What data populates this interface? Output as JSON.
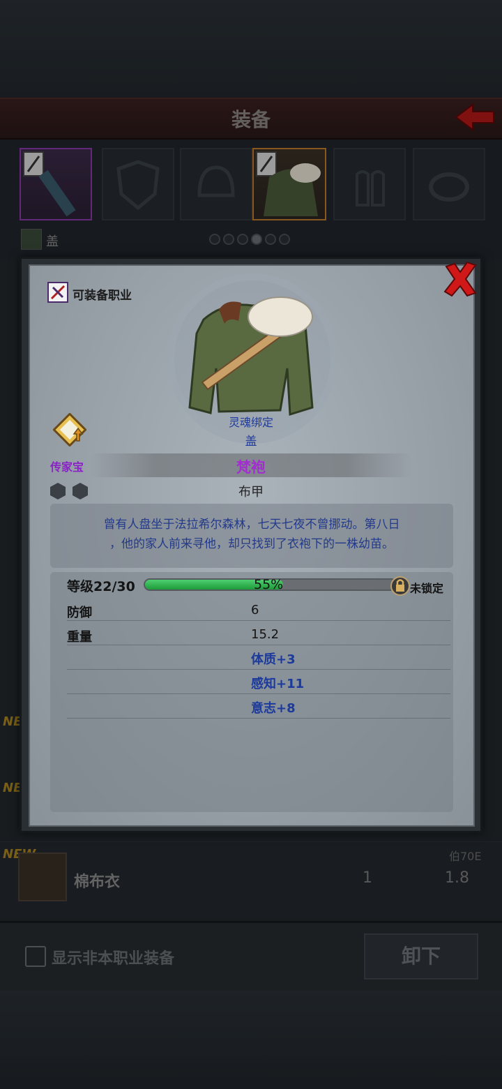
{
  "header": {
    "title": "装备"
  },
  "slots": {
    "character_name": "盖",
    "page_count": 6,
    "active_page": 4
  },
  "list": {
    "new_tags": [
      "NEW",
      "NEW",
      "NEW"
    ],
    "visible_item": {
      "name": "棉布衣",
      "requirement": "伯70E",
      "value1": "1",
      "value2": "1.8"
    }
  },
  "bottom_bar": {
    "show_other_class_label": "显示非本职业装备",
    "unequip_label": "卸下"
  },
  "modal": {
    "class_label": "可装备职业",
    "soulbound": "灵魂绑定",
    "owner": "盖",
    "heirloom": "传家宝",
    "item_name": "梵袍",
    "item_type": "布甲",
    "description": [
      "曾有人盘坐于法拉希尔森林，七天七夜不曾挪动。第八日",
      "，他的家人前来寻他，却只找到了衣袍下的一株幼苗。"
    ],
    "level": {
      "label": "等级22/30",
      "progress_text": "55%",
      "progress": 0.55
    },
    "lock_label": "未锁定",
    "stats": [
      {
        "label": "防御",
        "value": "6"
      },
      {
        "label": "重量",
        "value": "15.2"
      }
    ],
    "bonuses": [
      "体质+3",
      "感知+11",
      "意志+8"
    ]
  },
  "colors": {
    "rarity_purple": "#a22ed0",
    "bonus_blue": "#1c3a9c",
    "progress_green": "#2ab04a",
    "close_red": "#d01818"
  }
}
